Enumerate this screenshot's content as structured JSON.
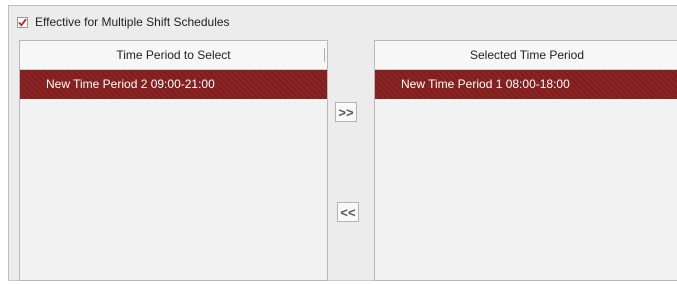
{
  "option": {
    "checked": true,
    "label": "Effective for Multiple Shift Schedules",
    "check_color": "#c0272d"
  },
  "available": {
    "header": "Time Period to Select",
    "items": [
      "New Time Period 2 09:00-21:00"
    ]
  },
  "selected": {
    "header": "Selected Time Period",
    "items": [
      "New Time Period 1 08:00-18:00"
    ]
  },
  "buttons": {
    "add": ">>",
    "remove": "<<"
  },
  "colors": {
    "row_highlight": "#7f1d1d",
    "panel_bg": "#f2f2f2",
    "frame_bg": "#ececec"
  }
}
